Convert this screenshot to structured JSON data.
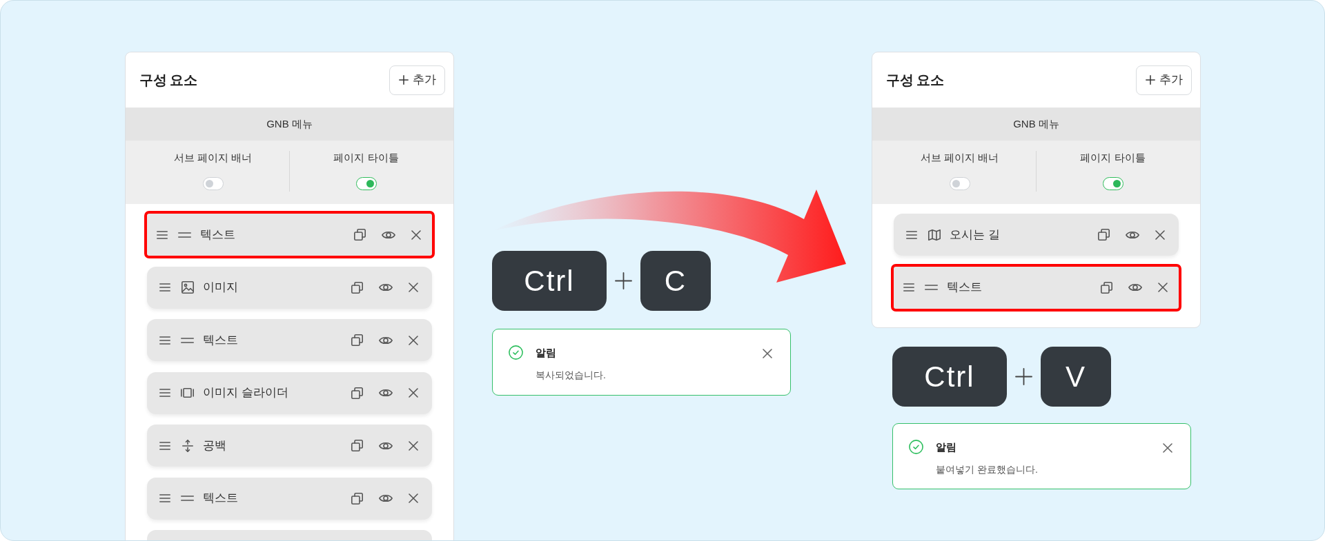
{
  "columns": [
    {
      "panel": {
        "title": "구성 요소",
        "add_button": "추가",
        "section_title": "GNB 메뉴",
        "toggles": [
          {
            "label": "서브 페이지 배너",
            "on": false
          },
          {
            "label": "페이지 타이틀",
            "on": true
          }
        ],
        "items": [
          {
            "kind": "text",
            "label": "텍스트",
            "highlighted": true
          },
          {
            "kind": "image",
            "label": "이미지",
            "highlighted": false
          },
          {
            "kind": "text",
            "label": "텍스트",
            "highlighted": false
          },
          {
            "kind": "slider",
            "label": "이미지 슬라이더",
            "highlighted": false
          },
          {
            "kind": "spacer",
            "label": "공백",
            "highlighted": false
          },
          {
            "kind": "text",
            "label": "텍스트",
            "highlighted": false
          }
        ],
        "more_below": true
      }
    },
    {
      "shortcut": {
        "keys": [
          {
            "kind": "modifier",
            "label": "Ctrl"
          },
          {
            "kind": "letter",
            "label": "C"
          }
        ]
      },
      "toast": {
        "title": "알림",
        "message": "복사되었습니다."
      }
    },
    {
      "panel": {
        "title": "구성 요소",
        "add_button": "추가",
        "section_title": "GNB 메뉴",
        "toggles": [
          {
            "label": "서브 페이지 배너",
            "on": false
          },
          {
            "label": "페이지 타이틀",
            "on": true
          }
        ],
        "items": [
          {
            "kind": "map",
            "label": "오시는 길",
            "highlighted": false
          },
          {
            "kind": "text",
            "label": "텍스트",
            "highlighted": true
          }
        ]
      },
      "shortcut": {
        "keys": [
          {
            "kind": "modifier",
            "label": "Ctrl"
          },
          {
            "kind": "letter",
            "label": "V"
          }
        ]
      },
      "toast": {
        "title": "알림",
        "message": "붙여넣기 완료했습니다."
      }
    }
  ]
}
